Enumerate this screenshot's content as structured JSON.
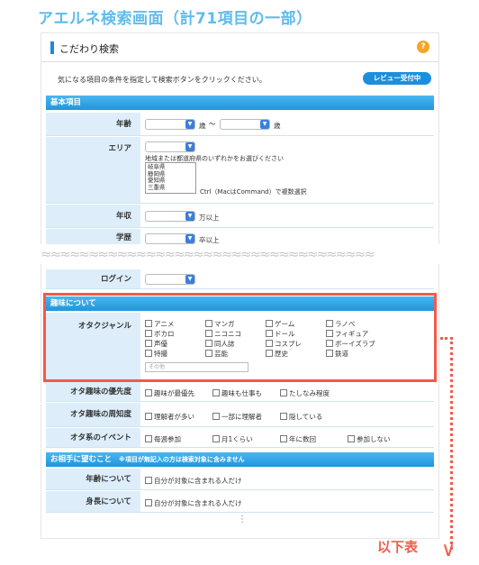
{
  "caption": "アエルネ検索画面（計71項目の一部）",
  "panel": {
    "title": "こだわり検索",
    "help_icon": "?",
    "intro": "気になる項目の条件を指定して検索ボタンをクリックください。",
    "review_button": "レビュー受付中"
  },
  "basic": {
    "section_title": "基本項目",
    "age": {
      "label": "年齢",
      "unit1": "歳",
      "tilde": "〜",
      "unit2": "歳"
    },
    "area": {
      "label": "エリア",
      "hint": "地域または都道府県のいずれかをお選びください",
      "options": [
        "岐阜県",
        "静岡県",
        "愛知県",
        "三重県"
      ],
      "multi_hint": "Ctrl（MacはCommand）で複数選択"
    },
    "income": {
      "label": "年収",
      "unit": "万以上"
    },
    "education": {
      "label": "学歴",
      "unit": "卒以上"
    },
    "login": {
      "label": "ログイン"
    }
  },
  "hobby": {
    "section_title": "趣味について",
    "otaku_genre": {
      "label": "オタクジャンル",
      "options": [
        "アニメ",
        "マンガ",
        "ゲーム",
        "ラノベ",
        "ボカロ",
        "ニコニコ",
        "ドール",
        "フィギュア",
        "声優",
        "同人誌",
        "コスプレ",
        "ボーイズラブ",
        "特撮",
        "芸能",
        "歴史",
        "鉄道"
      ],
      "other_placeholder": "その他"
    },
    "priority": {
      "label": "オタ趣味の優先度",
      "options": [
        "趣味が最優先",
        "趣味も仕事も",
        "たしなみ程度"
      ]
    },
    "awareness": {
      "label": "オタ趣味の周知度",
      "options": [
        "理解者が多い",
        "一部に理解者",
        "隠している"
      ]
    },
    "events": {
      "label": "オタ系のイベント",
      "options": [
        "毎週参加",
        "月1くらい",
        "年に数回",
        "参加しない"
      ]
    }
  },
  "partner": {
    "section_title": "お相手に望むこと",
    "note": "※項目が無記入の方は検索対象に含みません",
    "age": {
      "label": "年齢について",
      "option": "自分が対象に含まれる人だけ"
    },
    "height": {
      "label": "身長について",
      "option": "自分が対象に含まれる人だけ"
    }
  },
  "annotation": {
    "below_label": "以下表",
    "more": "⋮"
  }
}
